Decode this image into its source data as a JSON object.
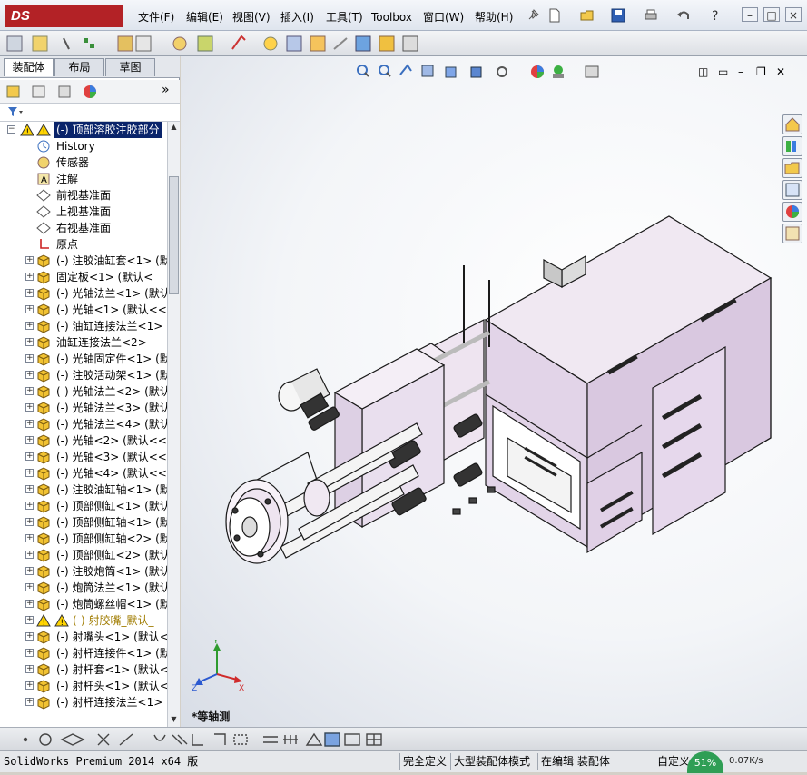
{
  "app": {
    "logo_text": "DS SOLIDWORKS"
  },
  "menu": [
    "文件(F)",
    "编辑(E)",
    "视图(V)",
    "插入(I)",
    "工具(T)",
    "Toolbox",
    "窗口(W)",
    "帮助(H)"
  ],
  "panel_tabs": [
    "装配体",
    "布局",
    "草图"
  ],
  "tree": [
    {
      "label": "(-) 顶部溶胶注胶部分",
      "icon": "assembly-warning-icon",
      "expanded": true,
      "level": 0,
      "selected": true
    },
    {
      "label": "History",
      "icon": "history-icon",
      "level": 1
    },
    {
      "label": "传感器",
      "icon": "sensor-icon",
      "level": 1
    },
    {
      "label": "注解",
      "icon": "annotation-icon",
      "level": 1
    },
    {
      "label": "前视基准面",
      "icon": "plane-icon",
      "level": 1
    },
    {
      "label": "上视基准面",
      "icon": "plane-icon",
      "level": 1
    },
    {
      "label": "右视基准面",
      "icon": "plane-icon",
      "level": 1
    },
    {
      "label": "原点",
      "icon": "origin-icon",
      "level": 1
    },
    {
      "label": "(-) 注胶油缸套<1> (默",
      "icon": "part-icon",
      "level": 1,
      "collapsed": true
    },
    {
      "label": "固定板<1> (默认<",
      "icon": "part-icon",
      "level": 1,
      "collapsed": true
    },
    {
      "label": "(-) 光轴法兰<1> (默认",
      "icon": "part-icon",
      "level": 1,
      "collapsed": true
    },
    {
      "label": "(-) 光轴<1> (默认<<默",
      "icon": "part-icon",
      "level": 1,
      "collapsed": true
    },
    {
      "label": "(-) 油缸连接法兰<1>",
      "icon": "part-icon",
      "level": 1,
      "collapsed": true
    },
    {
      "label": "油缸连接法兰<2>",
      "icon": "part-icon",
      "level": 1,
      "collapsed": true
    },
    {
      "label": "(-) 光轴固定件<1> (默",
      "icon": "part-icon",
      "level": 1,
      "collapsed": true
    },
    {
      "label": "(-) 注胶活动架<1> (默",
      "icon": "part-icon",
      "level": 1,
      "collapsed": true
    },
    {
      "label": "(-) 光轴法兰<2> (默认",
      "icon": "part-icon",
      "level": 1,
      "collapsed": true
    },
    {
      "label": "(-) 光轴法兰<3> (默认",
      "icon": "part-icon",
      "level": 1,
      "collapsed": true
    },
    {
      "label": "(-) 光轴法兰<4> (默认",
      "icon": "part-icon",
      "level": 1,
      "collapsed": true
    },
    {
      "label": "(-) 光轴<2> (默认<<默",
      "icon": "part-icon",
      "level": 1,
      "collapsed": true
    },
    {
      "label": "(-) 光轴<3> (默认<<默",
      "icon": "part-icon",
      "level": 1,
      "collapsed": true
    },
    {
      "label": "(-) 光轴<4> (默认<<默",
      "icon": "part-icon",
      "level": 1,
      "collapsed": true
    },
    {
      "label": "(-) 注胶油缸轴<1> (默",
      "icon": "part-icon",
      "level": 1,
      "collapsed": true
    },
    {
      "label": "(-) 顶部侧缸<1> (默认",
      "icon": "part-icon",
      "level": 1,
      "collapsed": true
    },
    {
      "label": "(-) 顶部侧缸轴<1> (默",
      "icon": "part-icon",
      "level": 1,
      "collapsed": true
    },
    {
      "label": "(-) 顶部侧缸轴<2> (默",
      "icon": "part-icon",
      "level": 1,
      "collapsed": true
    },
    {
      "label": "(-) 顶部侧缸<2> (默认",
      "icon": "part-icon",
      "level": 1,
      "collapsed": true
    },
    {
      "label": "(-) 注胶炮筒<1> (默认",
      "icon": "part-icon",
      "level": 1,
      "collapsed": true
    },
    {
      "label": "(-) 炮筒法兰<1> (默认",
      "icon": "part-icon",
      "level": 1,
      "collapsed": true
    },
    {
      "label": "(-) 炮筒螺丝帽<1> (默",
      "icon": "part-icon",
      "level": 1,
      "collapsed": true
    },
    {
      "label": "(-) 射胶嘴_默认_",
      "icon": "assembly-warning-icon",
      "level": 1,
      "collapsed": true,
      "warning": true
    },
    {
      "label": "(-) 射嘴头<1> (默认<",
      "icon": "part-icon",
      "level": 1,
      "collapsed": true
    },
    {
      "label": "(-) 射杆连接件<1> (默",
      "icon": "part-icon",
      "level": 1,
      "collapsed": true
    },
    {
      "label": "(-) 射杆套<1> (默认<",
      "icon": "part-icon",
      "level": 1,
      "collapsed": true
    },
    {
      "label": "(-) 射杆头<1> (默认<",
      "icon": "part-icon",
      "level": 1,
      "collapsed": true
    },
    {
      "label": "(-) 射杆连接法兰<1>",
      "icon": "part-icon",
      "level": 1,
      "collapsed": true
    }
  ],
  "viewport": {
    "view_label": "*等轴测",
    "triad": {
      "x": "X",
      "y": "Y",
      "z": "Z"
    }
  },
  "status": {
    "product": "SolidWorks Premium 2014 x64 版",
    "fields": [
      "完全定义",
      "大型装配体模式",
      "在编辑 装配体",
      "自定义"
    ],
    "net_speed": "0.07K/s",
    "cpu": "51%"
  },
  "colors": {
    "selection": "#0a246a",
    "model_face": "#e8dcec",
    "model_edge": "#1a1a1a",
    "brand": "#b32226"
  }
}
